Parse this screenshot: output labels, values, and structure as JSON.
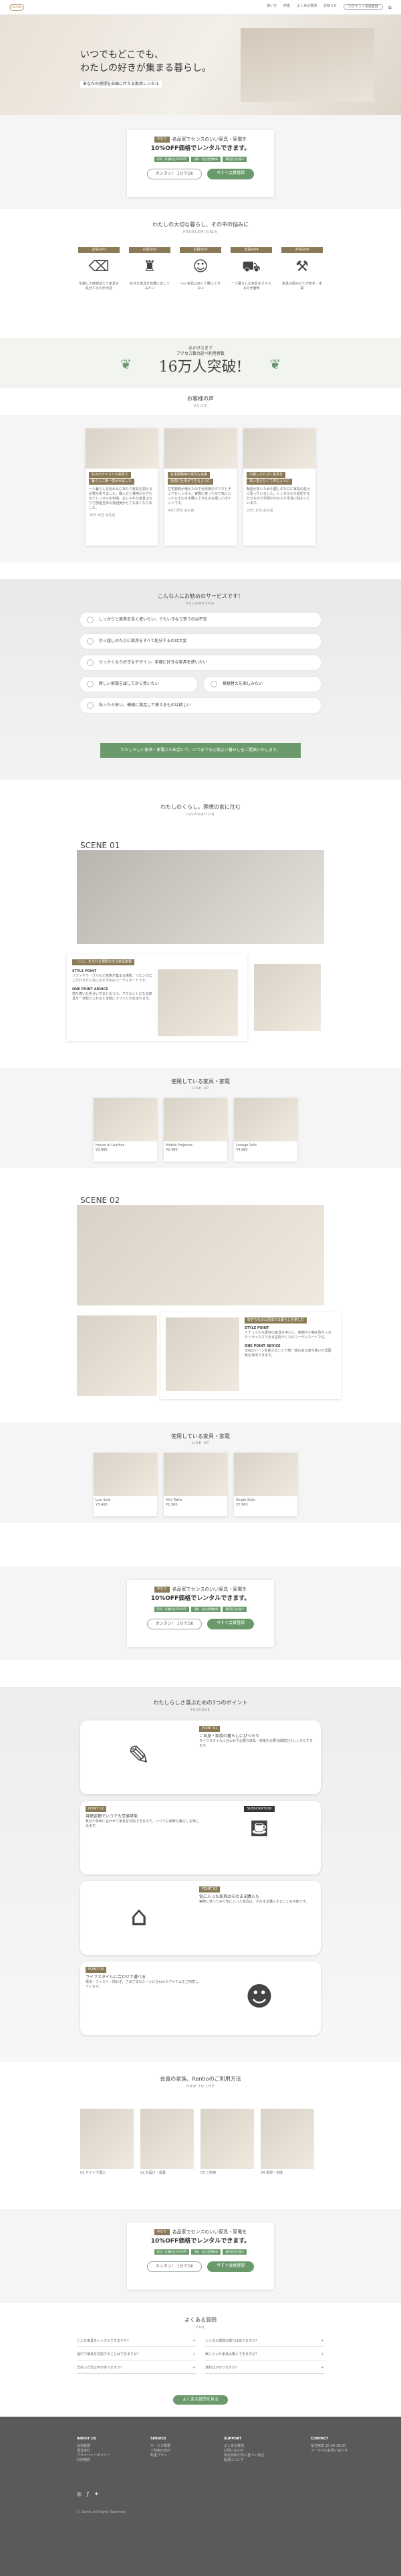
{
  "header": {
    "logo": "Rentio",
    "nav": [
      "使い方",
      "料金",
      "よくある質問",
      "お知らせ",
      "ログイン / 会員登録"
    ]
  },
  "hero": {
    "line1": "いつでもどこでも、",
    "line2": "わたしの好きが集まる暮らし。",
    "sub": "あなたの理想を自由に叶える家具レンタル"
  },
  "cta": {
    "badge": "今なら",
    "title": "名品家でセンスのいい家具・家電を",
    "title2": "10%OFF価格でレンタルできます。",
    "pill1": "初月・月額料金10%OFF",
    "pill2": "送料・組立設置無料",
    "pill3": "最短翌日お届け",
    "btn_outline": "カンタン！ 1分でOK",
    "btn_green": "今すぐ会員登録"
  },
  "problems": {
    "title": "わたしの大切な暮らし、その中の悩みに",
    "sub": "PROBLEM/お悩み",
    "items": [
      {
        "tag": "お悩み01",
        "text": "引越しや模様替えで家具を処分するのが大変"
      },
      {
        "tag": "お悩み02",
        "text": "好きな家具を気軽に試してみたい"
      },
      {
        "tag": "お悩み03",
        "text": "いい家具は高くて購入できない"
      },
      {
        "tag": "お悩み04",
        "text": "一人暮らしの家具をそろえるのが面倒"
      },
      {
        "tag": "お悩み05",
        "text": "家具の組み立てが苦手・手間"
      }
    ]
  },
  "record": {
    "small": "おかげさまで",
    "mid": "アクセス数の延べ利用者数",
    "big": "16万人突破!"
  },
  "voices": {
    "title": "お客様の声",
    "sub": "VOICE",
    "items": [
      {
        "tag": "好みのテイストの家具で",
        "title": "暮らしに統一感が出ました",
        "text": "一人暮らしを始めるにあたり家具を揃える必要がありました。購入だと費用がかさむのでレンタルを利用。おしゃれな家具ばかりで部屋全体の雰囲気がとても良くなりました。",
        "name": "30代 女性 会社員"
      },
      {
        "tag": "在宅勤務用の家具も充実",
        "title": "快適に仕事ができるように",
        "text": "在宅勤務が増えたので仕事用のデスクとチェアをレンタル。実際に使ってみて気に入ったらそのまま購入できるのも嬉しいポイントです。",
        "name": "40代 男性 会社員"
      },
      {
        "tag": "引越しのたびに家具を",
        "title": "買い替えなくて済むように",
        "text": "転勤が多いため引越しのたびに家具の処分に困っていました。レンタルなら返却するだけなので手間がかからず本当に助かっています。",
        "name": "20代 女性 会社員"
      }
    ]
  },
  "checklist": {
    "title": "こんな人にお勧めのサービスです！",
    "sub": "RECOMMEND",
    "items": [
      "しっかりと家具を長く使いたい、でもいきなり買うのは不安",
      "引っ越しのたびに家具をすべて処分するのは大変",
      "せっかくなら好きなデザイン、手軽に好きな家具を使いたい",
      "新しい家電を試してから買いたい",
      "模様替えを楽しみたい",
      "私ったら安い。模様に満足して使えるものは欲しい"
    ],
    "banner": "わたしらしい家具・家電との出会いで、いつまでも心地よい暮らしをご提案いたします。"
  },
  "scenes": {
    "title": "わたしのくらし。理想の家に住む",
    "sub": "INSPIRATION",
    "s1": {
      "label": "SCENE 01",
      "tag": "「二人」をなれる場所の主な家具家電",
      "title": "STYLE POINT",
      "text": "ソファやテーブルなど家族が集まる場所、リビングにこだわりたい方におすすめのコーディネートです。",
      "point": "ONE POINT ADVICE",
      "advice": "落ち着いた色合いでまとめつつ、アクセントになる家具を一点取り入れると空間にメリハリが生まれます。"
    },
    "s1list": {
      "title": "使用している家具・家電",
      "sub": "LINE UP",
      "items": [
        {
          "name": "House of Leather",
          "price": "¥3,980"
        },
        {
          "name": "Mobile Projector",
          "price": "¥2,480"
        },
        {
          "name": "Lounge Sofa",
          "price": "¥4,980"
        }
      ]
    },
    "s2": {
      "label": "SCENE 02",
      "tag": "好きなものに囲まれる暮らしを楽しむ",
      "title": "STYLE POINT",
      "text": "ナチュラルな素材の家具を中心に、植物や小物を取り入れたリラックスできる空間づくりのコーディネートです。",
      "point": "ONE POINT ADVICE",
      "advice": "木目のトーンを揃えることで統一感のある落ち着いた雰囲気を演出できます。"
    },
    "s2list": {
      "title": "使用している家具・家電",
      "sub": "LINE UP",
      "items": [
        {
          "name": "Low Sofa",
          "price": "¥3,480"
        },
        {
          "name": "Mini Table",
          "price": "¥1,980"
        },
        {
          "name": "Single Sofa",
          "price": "¥2,980"
        }
      ]
    }
  },
  "features": {
    "title": "わたしらしさ選ぶための3つのポイント",
    "sub": "FEATURE",
    "items": [
      {
        "tag": "POINT 01",
        "title": "ご自身・家族の暮らしにぴったり",
        "text": "ライフスタイルに合わせて必要な家具・家電を必要な期間だけレンタルできます。"
      },
      {
        "tag": "POINT 02",
        "badge": "SUBSCRIPTION",
        "title": "月額定額でいつでも交換可能",
        "text": "気分や季節に合わせて家具を交換できるので、いつでも新鮮な暮らしを楽しめます。"
      },
      {
        "tag": "POINT 03",
        "title": "気に入った家具はそのまま購入も",
        "text": "実際に使ってみて気に入った家具は、そのまま購入することも可能です。"
      },
      {
        "tag": "POINT 04",
        "title": "ライフスタイルに合わせて選べる",
        "text": "単身・ファミリー問わず、さまざまなシーンに合わせたアイテムをご用意しています。"
      }
    ]
  },
  "howto": {
    "title": "会員の家族、Rentioのご利用方法",
    "sub": "HOW TO USE",
    "steps": [
      {
        "n": "01",
        "t": "サイトで選ぶ"
      },
      {
        "n": "02",
        "t": "お届け・設置"
      },
      {
        "n": "03",
        "t": "ご利用"
      },
      {
        "n": "04",
        "t": "返却・交換"
      }
    ]
  },
  "faq": {
    "title": "よくある質問",
    "sub": "FAQ",
    "items": [
      "どんな家具をレンタルできますか？",
      "レンタル期間の縛りはありますか？",
      "途中で家具を交換することはできますか？",
      "気に入った家具は購入できますか？",
      "支払い方法は何がありますか？",
      "送料はかかりますか？"
    ],
    "more": "よくある質問を見る"
  },
  "footer": {
    "cols": [
      {
        "h": "ABOUT US",
        "items": [
          "会社概要",
          "運営会社",
          "プライバシーポリシー",
          "利用規約"
        ]
      },
      {
        "h": "SERVICE",
        "items": [
          "サービス概要",
          "ご利用の流れ",
          "料金プラン"
        ]
      },
      {
        "h": "SUPPORT",
        "items": [
          "よくある質問",
          "お問い合わせ",
          "特定商取引法に基づく表記",
          "配送について"
        ]
      },
      {
        "h": "CONTACT",
        "items": [
          "受付時間 10:00-18:00",
          "メールでのお問い合わせ"
        ]
      }
    ],
    "copy": "© Rentio All Rights Reserved."
  }
}
